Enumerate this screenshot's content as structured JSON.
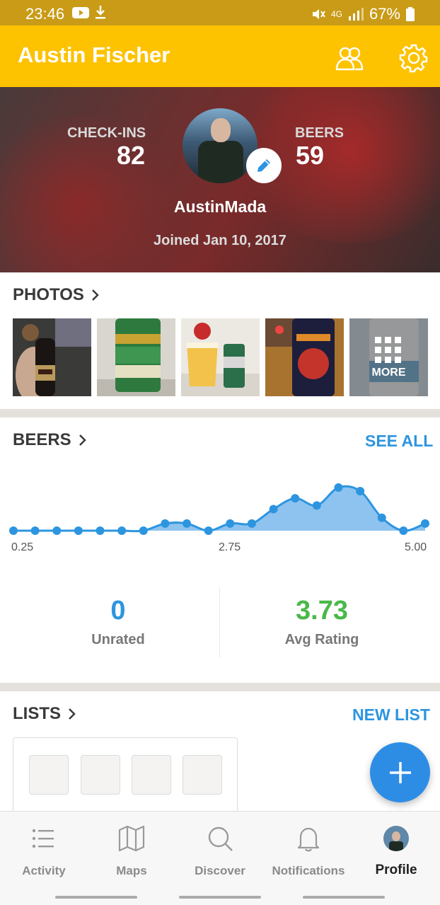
{
  "status_bar": {
    "time": "23:46",
    "network": "4G",
    "battery": "67%"
  },
  "app_bar": {
    "title": "Austin Fischer"
  },
  "profile": {
    "checkins_label": "CHECK-INS",
    "checkins_value": "82",
    "beers_label": "BEERS",
    "beers_value": "59",
    "username": "AustinMada",
    "joined": "Joined Jan 10, 2017"
  },
  "photos": {
    "title": "PHOTOS",
    "more_label": "MORE"
  },
  "beers_section": {
    "title": "BEERS",
    "see_all": "SEE ALL",
    "unrated_value": "0",
    "unrated_label": "Unrated",
    "avg_value": "3.73",
    "avg_label": "Avg Rating"
  },
  "chart_data": {
    "type": "area",
    "x": [
      0.25,
      0.5,
      0.75,
      1.0,
      1.25,
      1.5,
      1.75,
      2.0,
      2.25,
      2.5,
      2.75,
      3.0,
      3.25,
      3.5,
      3.75,
      4.0,
      4.25,
      4.5,
      4.75,
      5.0
    ],
    "values": [
      0,
      0,
      0,
      0,
      0,
      0,
      0,
      1,
      1,
      0,
      1,
      1,
      3,
      4.5,
      3.5,
      6,
      5.5,
      1.8,
      0,
      1
    ],
    "tick_labels": [
      "0.25",
      "2.75",
      "5.00"
    ],
    "colors": {
      "line": "#2d95e0",
      "fill": "#8ec3ef"
    }
  },
  "lists": {
    "title": "LISTS",
    "new_list": "NEW LIST"
  },
  "bottom_nav": {
    "items": [
      {
        "label": "Activity",
        "icon": "list-icon"
      },
      {
        "label": "Maps",
        "icon": "map-icon"
      },
      {
        "label": "Discover",
        "icon": "search-icon"
      },
      {
        "label": "Notifications",
        "icon": "bell-icon"
      },
      {
        "label": "Profile",
        "icon": "avatar-icon"
      }
    ]
  },
  "colors": {
    "accent": "#fdc200",
    "link": "#2d95e0",
    "positive": "#4ab84a"
  }
}
